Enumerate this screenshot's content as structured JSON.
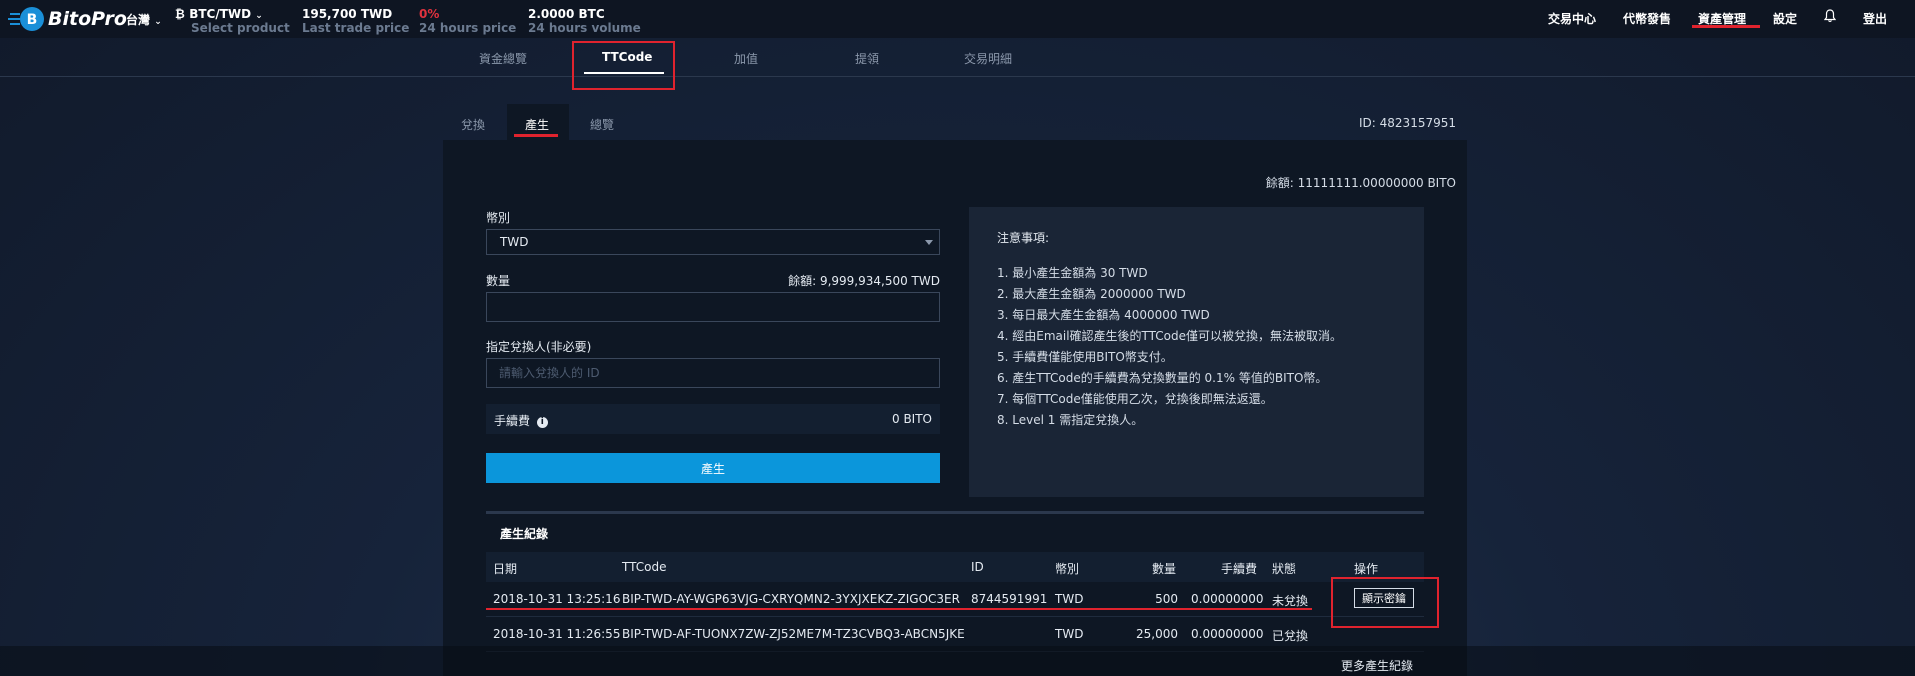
{
  "header": {
    "brand": "BitoPro",
    "region": "台灣",
    "pair": {
      "name": "BTC/TWD",
      "sub": "Select product"
    },
    "stats": [
      {
        "value": "195,700 TWD",
        "label": "Last trade price",
        "color": "#ffffff"
      },
      {
        "value": "0%",
        "label": "24 hours price",
        "color": "#e0323e"
      },
      {
        "value": "2.0000 BTC",
        "label": "24 hours volume",
        "color": "#ffffff"
      }
    ],
    "nav": [
      "交易中心",
      "代幣發售",
      "資產管理",
      "設定",
      "登出"
    ]
  },
  "subnav": [
    "資金總覽",
    "TTCode",
    "加值",
    "提領",
    "交易明細"
  ],
  "page_tabs": [
    "兌換",
    "產生",
    "總覽"
  ],
  "account_id": "ID: 4823157951",
  "balance": "餘額: 11111111.00000000 BITO",
  "form": {
    "currency_label": "幣別",
    "currency_value": "TWD",
    "amount_label": "數量",
    "available": "餘額: 9,999,934,500 TWD",
    "amount_value": "",
    "recipient_label": "指定兌換人(非必要)",
    "recipient_placeholder": "請輸入兌換人的 ID",
    "fee_label": "手續費",
    "fee_value": "0 BITO",
    "submit_label": "產生"
  },
  "notes": {
    "title": "注意事項:",
    "items": [
      "1. 最小產生金額為 30 TWD",
      "2. 最大產生金額為 2000000 TWD",
      "3. 每日最大產生金額為 4000000 TWD",
      "4. 經由Email確認產生後的TTCode僅可以被兌換，無法被取消。",
      "5. 手續費僅能使用BITO幣支付。",
      "6. 產生TTCode的手續費為兌換數量的 0.1% 等值的BITO幣。",
      "7. 每個TTCode僅能使用乙次，兌換後即無法返還。",
      "8. Level 1 需指定兌換人。"
    ]
  },
  "records": {
    "title": "產生紀錄",
    "columns": [
      "日期",
      "TTCode",
      "ID",
      "幣別",
      "數量",
      "手續費",
      "狀態",
      "操作"
    ],
    "rows": [
      {
        "date": "2018-10-31 13:25:16",
        "ttcode": "BIP-TWD-AY-WGP63VJG-CXRYQMN2-3YXJXEKZ-ZIGOC3ER",
        "id": "8744591991",
        "currency": "TWD",
        "amount": "500",
        "fee": "0.00000000",
        "status": "未兌換",
        "action": "顯示密鑰"
      },
      {
        "date": "2018-10-31 11:26:55",
        "ttcode": "BIP-TWD-AF-TUONX7ZW-ZJ52ME7M-TZ3CVBQ3-ABCN5JKE",
        "id": "",
        "currency": "TWD",
        "amount": "25,000",
        "fee": "0.00000000",
        "status": "已兌換",
        "action": ""
      }
    ],
    "more": "更多產生紀錄"
  }
}
